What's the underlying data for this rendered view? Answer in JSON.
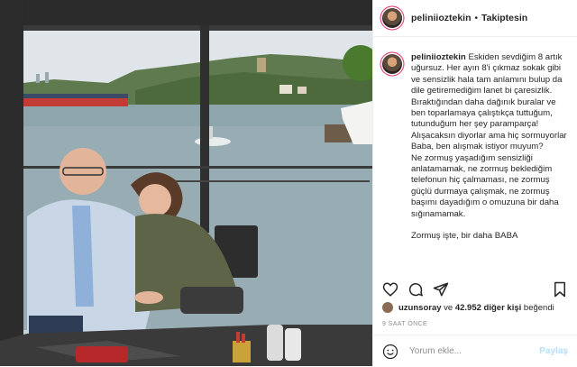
{
  "post": {
    "username": "peliniioztekin",
    "follow_label": "Takiptesin",
    "separator": "•",
    "caption": {
      "username": "peliniioztekin",
      "paragraphs": [
        "Eskiden sevdiğim 8 artık uğursuz. Her ayın 8'i çıkmaz sokak gibi ve sensizlik hala tam anlamını bulup da dile getiremediğim lanet bi çaresizlik.",
        "Bıraktığından daha dağınık buralar ve ben toparlamaya çalıştıkça tuttuğum, tutunduğum her şey paramparça! Alışacaksın diyorlar ama hiç sormuyorlar Baba, ben alışmak istiyor muyum?",
        "Ne zormuş yaşadığım sensizliği anlatamamak, ne zormuş beklediğim telefonun hiç çalmaması, ne zormuş güçlü durmaya çalışmak, ne zormuş başımı dayadığım o omuzuna bir daha sığınamamak.",
        "Zormuş işte, bir daha BABA"
      ]
    },
    "likes": {
      "liker": "uzunsoray",
      "connector": "ve",
      "count_text": "42.952 diğer kişi",
      "suffix": "beğendi"
    },
    "time_ago": "9 SAAT ÖNCE",
    "comment_placeholder": "Yorum ekle...",
    "share_label": "Paylaş"
  },
  "icons": [
    "heart-icon",
    "comment-icon",
    "share-icon",
    "bookmark-icon",
    "smiley-icon"
  ],
  "colors": {
    "accent_blue": "#b2dffc",
    "muted": "#8e8e8e",
    "text": "#262626"
  }
}
